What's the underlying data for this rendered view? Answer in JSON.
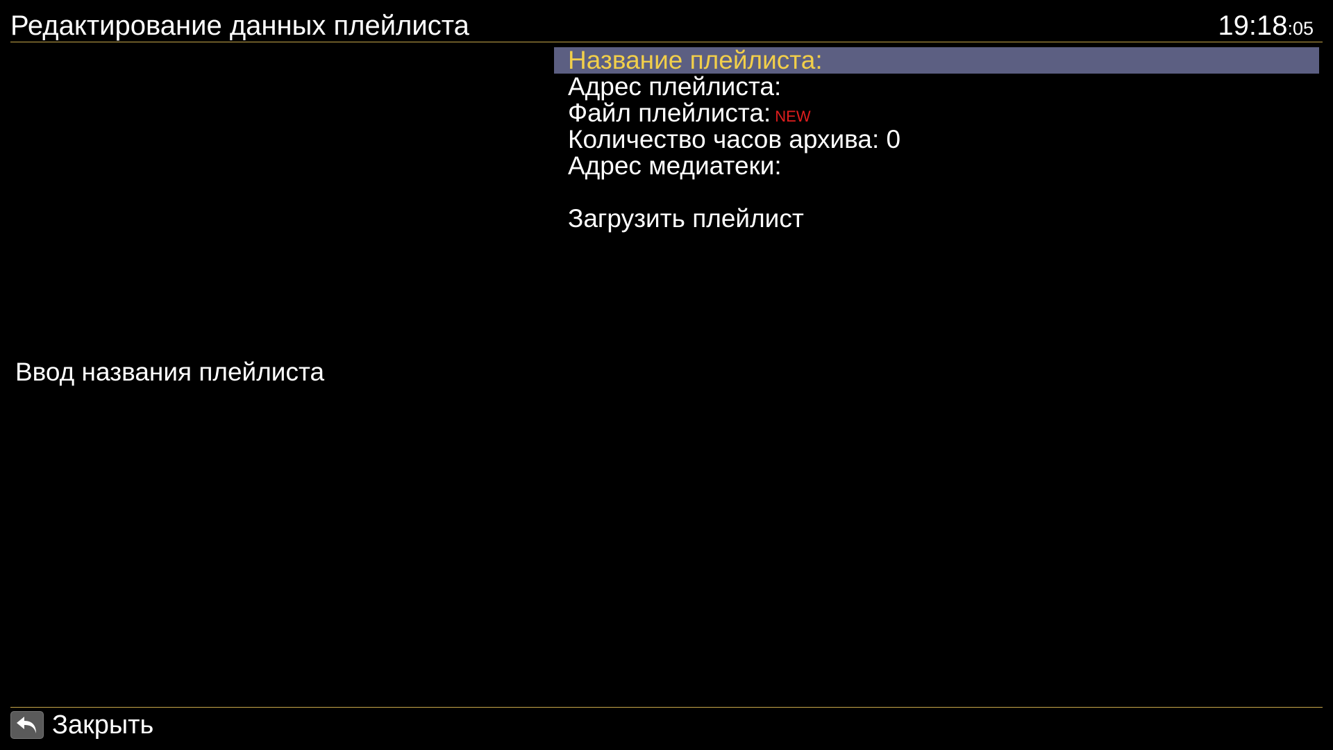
{
  "header": {
    "title": "Редактирование данных плейлиста",
    "clock_hm": "19:18",
    "clock_sec": ":05"
  },
  "menu": {
    "items": [
      {
        "label": "Название плейлиста:"
      },
      {
        "label": "Адрес плейлиста:"
      },
      {
        "label": "Файл плейлиста:",
        "badge": "NEW"
      },
      {
        "label": "Количество часов архива: 0"
      },
      {
        "label": "Адрес медиатеки:"
      },
      {
        "label": "Загрузить плейлист"
      }
    ]
  },
  "hint": {
    "text": "Ввод названия плейлиста"
  },
  "footer": {
    "back_icon": "return-arrow-icon",
    "close_label": "Закрыть"
  },
  "colors": {
    "background": "#000000",
    "selected_bg": "#5c5f82",
    "selected_text": "#f2cf4a",
    "rule": "#c9a94a",
    "new_badge": "#e01e1e"
  }
}
